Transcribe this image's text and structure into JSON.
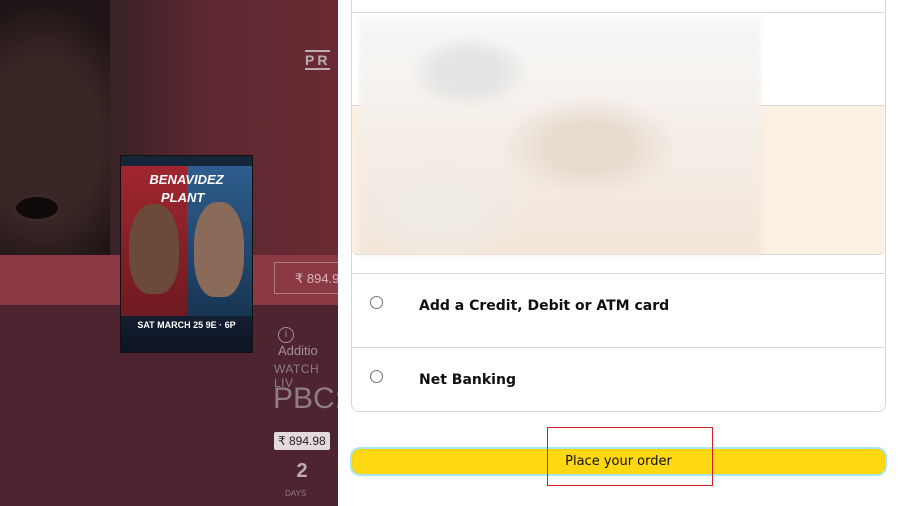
{
  "background_page": {
    "header_partial": "PR",
    "price_box": "₹ 894.9",
    "info_link": "Additio",
    "watch_label": "WATCH LIV",
    "event_title_partial": "PBC:",
    "price_badge": "₹ 894.98",
    "countdown_value": "2",
    "countdown_unit": "DAYS",
    "poster": {
      "fighter_1": "BENAVIDEZ",
      "fighter_2": "PLANT",
      "date_text": "SAT MARCH 25 9E · 6P"
    }
  },
  "checkout": {
    "payment_options": [
      {
        "label": "Add a Credit, Debit or ATM card",
        "selected": false
      },
      {
        "label": "Net Banking",
        "selected": false
      }
    ],
    "place_order_label": "Place your order"
  },
  "colors": {
    "place_order_bg": "#ffd814",
    "focus_ring": "#a6e7f3",
    "highlight_box": "#d02020",
    "upi_section_bg": "#fcefe3"
  }
}
